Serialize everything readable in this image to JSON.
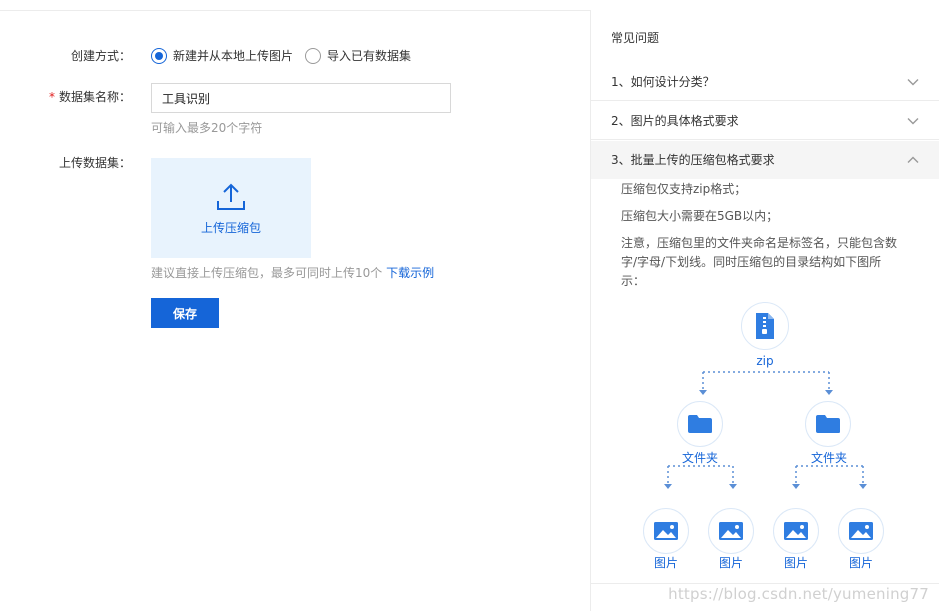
{
  "form": {
    "create_mode": {
      "label": "创建方式：",
      "options": [
        {
          "label": "新建并从本地上传图片",
          "checked": true
        },
        {
          "label": "导入已有数据集",
          "checked": false
        }
      ]
    },
    "dataset_name": {
      "required_mark": "*",
      "label": "数据集名称：",
      "value": "工具识别",
      "hint": "可输入最多20个字符"
    },
    "upload": {
      "label": "上传数据集：",
      "box_label": "上传压缩包",
      "hint": "建议直接上传压缩包，最多可同时上传10个",
      "link": "下载示例"
    },
    "save_label": "保存"
  },
  "faq": {
    "title": "常见问题",
    "items": [
      {
        "question": "1、如何设计分类？",
        "expanded": false
      },
      {
        "question": "2、图片的具体格式要求",
        "expanded": false
      },
      {
        "question": "3、批量上传的压缩包格式要求",
        "expanded": true
      }
    ],
    "answer": [
      "压缩包仅支持zip格式；",
      "压缩包大小需要在5GB以内；",
      "注意，压缩包里的文件夹命名是标签名，只能包含数字/字母/下划线。同时压缩包的目录结构如下图所示："
    ],
    "tree": {
      "root_label": "zip",
      "folder_label": "文件夹",
      "image_label": "图片"
    }
  },
  "watermark": "https://blog.csdn.net/yumening77",
  "colors": {
    "accent": "#1565d8",
    "upload_bg": "#e8f3fd",
    "required": "#e02020"
  }
}
